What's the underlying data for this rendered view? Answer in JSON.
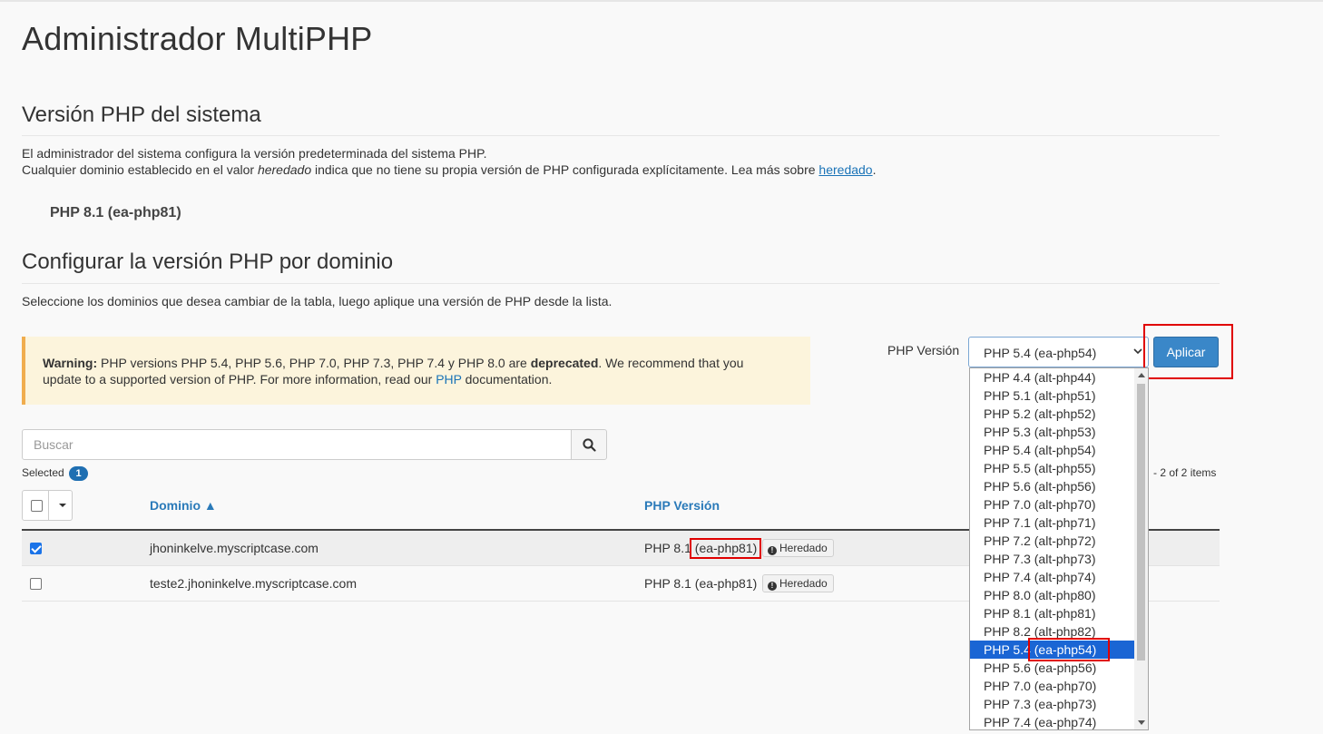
{
  "page": {
    "title": "Administrador MultiPHP"
  },
  "system": {
    "heading": "Versión PHP del sistema",
    "line1": "El administrador del sistema configura la versión predeterminada del sistema PHP.",
    "line2_a": "Cualquier dominio establecido en el valor ",
    "line2_em": "heredado",
    "line2_b": " indica que no tiene su propia versión de PHP configurada explícitamente. Lea más sobre ",
    "line2_link": "heredado",
    "line2_end": ".",
    "current_version": "PHP 8.1 (ea-php81)"
  },
  "domains_section": {
    "heading": "Configurar la versión PHP por dominio",
    "instructions": "Seleccione los dominios que desea cambiar de la tabla, luego aplique una versión de PHP desde la lista."
  },
  "warning": {
    "label": "Warning:",
    "text_a": " PHP versions PHP 5.4, PHP 5.6, PHP 7.0, PHP 7.3, PHP 7.4 y PHP 8.0 are ",
    "strong": "deprecated",
    "text_b": ". We recommend that you update to a supported version of PHP. For more information, read our ",
    "link": "PHP",
    "text_c": " documentation."
  },
  "version_picker": {
    "label": "PHP Versión",
    "selected": "PHP 5.4 (ea-php54)",
    "apply_label": "Aplicar",
    "options": [
      "PHP 4.4 (alt-php44)",
      "PHP 5.1 (alt-php51)",
      "PHP 5.2 (alt-php52)",
      "PHP 5.3 (alt-php53)",
      "PHP 5.4 (alt-php54)",
      "PHP 5.5 (alt-php55)",
      "PHP 5.6 (alt-php56)",
      "PHP 7.0 (alt-php70)",
      "PHP 7.1 (alt-php71)",
      "PHP 7.2 (alt-php72)",
      "PHP 7.3 (alt-php73)",
      "PHP 7.4 (alt-php74)",
      "PHP 8.0 (alt-php80)",
      "PHP 8.1 (alt-php81)",
      "PHP 8.2 (alt-php82)",
      "PHP 5.4 (ea-php54)",
      "PHP 5.6 (ea-php56)",
      "PHP 7.0 (ea-php70)",
      "PHP 7.3 (ea-php73)",
      "PHP 7.4 (ea-php74)"
    ],
    "highlighted_index": 15
  },
  "search": {
    "placeholder": "Buscar",
    "icon": "search-icon"
  },
  "selection": {
    "label": "Selected",
    "count": "1",
    "items_info": "- 2 of 2 items"
  },
  "table": {
    "headers": {
      "domain": "Dominio ▲",
      "version": "PHP Versión"
    },
    "rows": [
      {
        "domain": "jhoninkelve.myscriptcase.com",
        "version_prefix": "PHP 8.1 ",
        "version_code": "(ea-php81)",
        "inherited": "Heredado",
        "checked": true
      },
      {
        "domain": "teste2.jhoninkelve.myscriptcase.com",
        "version_prefix": "PHP 8.1 ",
        "version_code": "(ea-php81)",
        "inherited": "Heredado",
        "checked": false
      }
    ]
  },
  "colors": {
    "link": "#1a73b7",
    "apply_button": "#3a87c8",
    "highlight": "#e00000",
    "selected_option": "#1a65d4",
    "warning_bg": "#fcf4dc"
  }
}
